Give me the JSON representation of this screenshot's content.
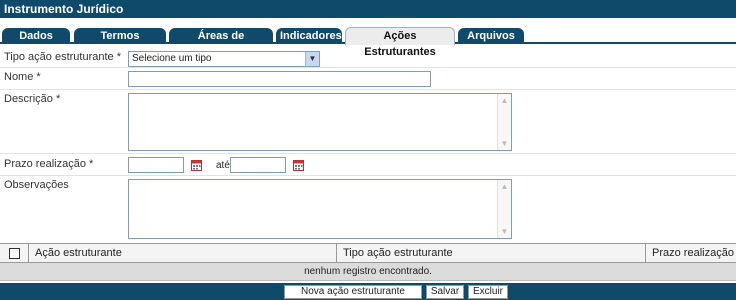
{
  "window": {
    "title": "Instrumento Jurídico"
  },
  "tabs": [
    {
      "label": "Dados Gerais"
    },
    {
      "label": "Termos Aditivos"
    },
    {
      "label": "Áreas de Resultado"
    },
    {
      "label": "Indicadores"
    },
    {
      "label": "Ações Estruturantes",
      "active": true
    },
    {
      "label": "Arquivos"
    }
  ],
  "form": {
    "tipo": {
      "label": "Tipo ação estruturante",
      "required": "*",
      "selected": "Selecione um tipo"
    },
    "nome": {
      "label": "Nome",
      "required": "*",
      "value": ""
    },
    "descricao": {
      "label": "Descrição",
      "required": "*",
      "value": ""
    },
    "prazo": {
      "label": "Prazo realização",
      "required": "*",
      "from": "",
      "to": "",
      "ate": "até"
    },
    "observacoes": {
      "label": "Observações",
      "value": ""
    }
  },
  "table": {
    "columns": [
      "Ação estruturante",
      "Tipo ação estruturante",
      "Prazo realização"
    ],
    "empty_message": "nenhum registro encontrado."
  },
  "buttons": {
    "new": "Nova ação estruturante",
    "save": "Salvar",
    "delete": "Excluir"
  },
  "icons": {
    "calendar": "calendar-icon",
    "dropdown": "chevron-down-icon"
  }
}
